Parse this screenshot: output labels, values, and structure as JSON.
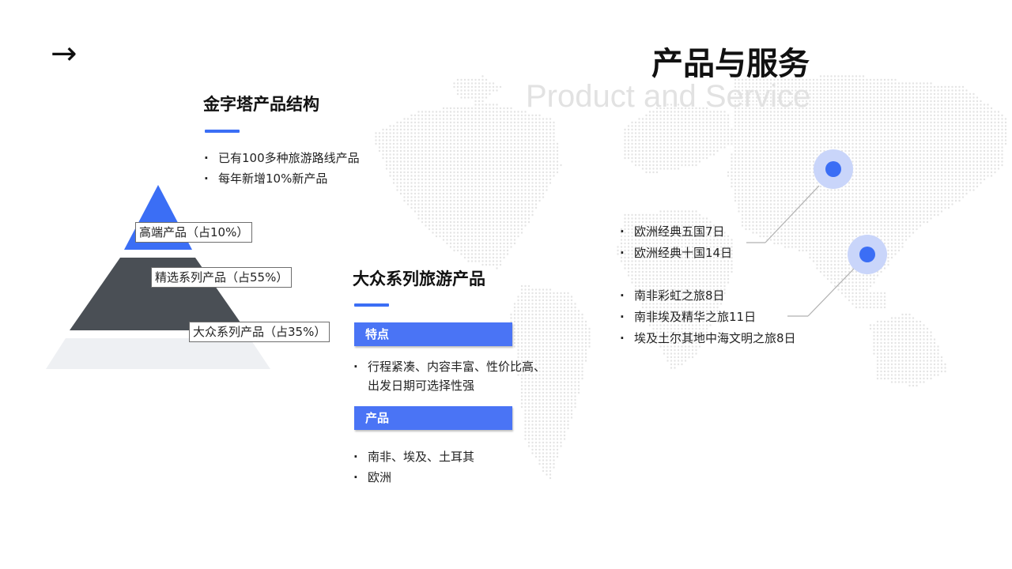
{
  "header": {
    "arrow": "→",
    "title": "产品与服务",
    "subtitle": "Product and Service"
  },
  "pyramid": {
    "title": "金字塔产品结构",
    "bullets": [
      "已有100多种旅游路线产品",
      "每年新增10%新产品"
    ],
    "levels": [
      {
        "label": "高端产品（占10%）",
        "share": 10,
        "color": "#3b6ef5"
      },
      {
        "label": "精选系列产品（占55%）",
        "share": 55,
        "color": "#4a4f55"
      },
      {
        "label": "大众系列产品（占35%）",
        "share": 35,
        "color": "#eef0f3"
      }
    ]
  },
  "mass_series": {
    "title": "大众系列旅游产品",
    "features_tag": "特点",
    "features": [
      "行程紧凑、内容丰富、性价比高、出发日期可选择性强"
    ],
    "products_tag": "产品",
    "products": [
      "南非、埃及、土耳其",
      "欧洲"
    ]
  },
  "map": {
    "group_europe": [
      "欧洲经典五国7日",
      "欧洲经典十国14日"
    ],
    "group_africa": [
      "南非彩虹之旅8日",
      "南非埃及精华之旅11日",
      "埃及土尔其地中海文明之旅8日"
    ],
    "colors": {
      "marker": "#3b6ef5",
      "halo": "#c9d5fa",
      "dots": "#e4e4e4",
      "leader": "#b0b0b0"
    }
  }
}
